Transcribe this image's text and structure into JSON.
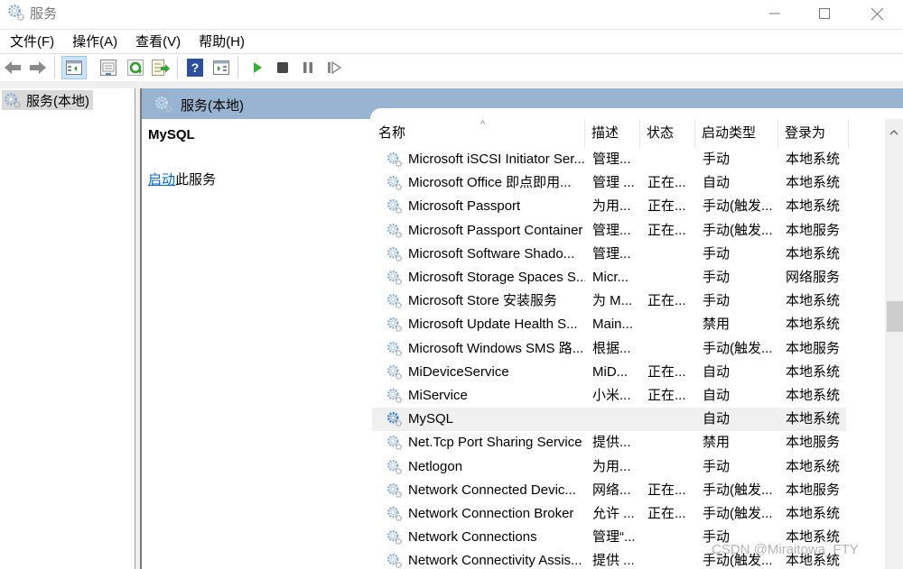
{
  "window": {
    "title": "服务",
    "minimize_icon": "minimize-icon",
    "maximize_icon": "maximize-icon",
    "close_icon": "close-icon"
  },
  "menu": [
    {
      "label": "文件(F)"
    },
    {
      "label": "操作(A)"
    },
    {
      "label": "查看(V)"
    },
    {
      "label": "帮助(H)"
    }
  ],
  "toolbar": {
    "buttons": [
      {
        "name": "back",
        "icon": "back-arrow-icon"
      },
      {
        "name": "forward",
        "icon": "forward-arrow-icon"
      },
      {
        "name": "show-hide-console-tree",
        "icon": "console-tree-icon",
        "active": true
      },
      {
        "name": "properties",
        "icon": "properties-icon"
      },
      {
        "name": "refresh",
        "icon": "refresh-icon"
      },
      {
        "name": "export-list",
        "icon": "export-list-icon"
      },
      {
        "name": "help",
        "icon": "help-icon"
      },
      {
        "name": "show-hide-action-pane",
        "icon": "action-pane-icon"
      },
      {
        "name": "start-service",
        "icon": "play-icon"
      },
      {
        "name": "stop-service",
        "icon": "stop-icon"
      },
      {
        "name": "pause-service",
        "icon": "pause-icon"
      },
      {
        "name": "restart-service",
        "icon": "resume-icon"
      }
    ]
  },
  "tree": {
    "items": [
      {
        "label": "服务(本地)",
        "selected": true
      }
    ]
  },
  "content": {
    "header_title": "服务(本地)",
    "selected_service": "MySQL",
    "action_link": "启动",
    "action_suffix": "此服务"
  },
  "table": {
    "columns": [
      "名称",
      "描述",
      "状态",
      "启动类型",
      "登录为"
    ],
    "rows": [
      {
        "name": "Microsoft iSCSI Initiator Ser...",
        "desc": "管理...",
        "status": "",
        "startup": "手动",
        "logon": "本地系统"
      },
      {
        "name": "Microsoft Office 即点即用...",
        "desc": "管理 ...",
        "status": "正在...",
        "startup": "自动",
        "logon": "本地系统"
      },
      {
        "name": "Microsoft Passport",
        "desc": "为用...",
        "status": "正在...",
        "startup": "手动(触发...",
        "logon": "本地系统"
      },
      {
        "name": "Microsoft Passport Container",
        "desc": "管理...",
        "status": "正在...",
        "startup": "手动(触发...",
        "logon": "本地服务"
      },
      {
        "name": "Microsoft Software Shado...",
        "desc": "管理...",
        "status": "",
        "startup": "手动",
        "logon": "本地系统"
      },
      {
        "name": "Microsoft Storage Spaces S...",
        "desc": "Micr...",
        "status": "",
        "startup": "手动",
        "logon": "网络服务"
      },
      {
        "name": "Microsoft Store 安装服务",
        "desc": "为 M...",
        "status": "正在...",
        "startup": "手动",
        "logon": "本地系统"
      },
      {
        "name": "Microsoft Update Health S...",
        "desc": "Main...",
        "status": "",
        "startup": "禁用",
        "logon": "本地系统"
      },
      {
        "name": "Microsoft Windows SMS 路...",
        "desc": "根据...",
        "status": "",
        "startup": "手动(触发...",
        "logon": "本地服务"
      },
      {
        "name": "MiDeviceService",
        "desc": "MiD...",
        "status": "正在...",
        "startup": "自动",
        "logon": "本地系统"
      },
      {
        "name": "MiService",
        "desc": "小米...",
        "status": "正在...",
        "startup": "自动",
        "logon": "本地系统"
      },
      {
        "name": "MySQL",
        "desc": "",
        "status": "",
        "startup": "自动",
        "logon": "本地系统",
        "selected": true
      },
      {
        "name": "Net.Tcp Port Sharing Service",
        "desc": "提供...",
        "status": "",
        "startup": "禁用",
        "logon": "本地服务"
      },
      {
        "name": "Netlogon",
        "desc": "为用...",
        "status": "",
        "startup": "手动",
        "logon": "本地系统"
      },
      {
        "name": "Network Connected Devic...",
        "desc": "网络...",
        "status": "正在...",
        "startup": "手动(触发...",
        "logon": "本地服务"
      },
      {
        "name": "Network Connection Broker",
        "desc": "允许 ...",
        "status": "正在...",
        "startup": "手动(触发...",
        "logon": "本地系统"
      },
      {
        "name": "Network Connections",
        "desc": "管理“...",
        "status": "",
        "startup": "手动",
        "logon": "本地系统"
      },
      {
        "name": "Network Connectivity Assis...",
        "desc": "提供 ...",
        "status": "",
        "startup": "手动(触发...",
        "logon": "本地系统"
      }
    ]
  },
  "watermark": "CSDN @Miraitowa_FTY",
  "colors": {
    "header_bg": "#99b4d1",
    "link": "#0066cc",
    "selected_row": "#f0f0f0"
  }
}
